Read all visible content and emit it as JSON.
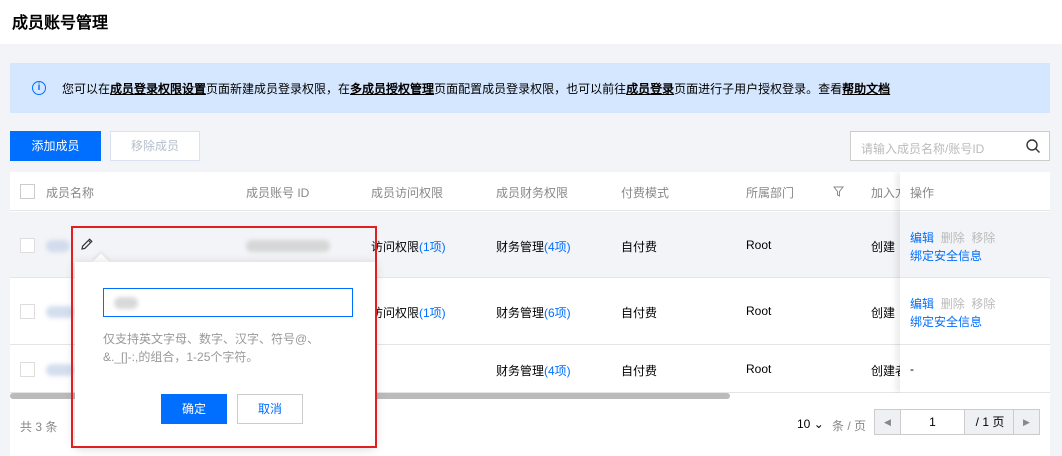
{
  "page": {
    "title": "成员账号管理"
  },
  "info": {
    "t1": "您可以在",
    "l1": "成员登录权限设置",
    "t2": "页面新建成员登录权限，在",
    "l2": "多成员授权管理",
    "t3": "页面配置成员登录权限，也可以前往",
    "l3": "成员登录",
    "t4": "页面进行子用户授权登录。查看",
    "l4": "帮助文档"
  },
  "toolbar": {
    "add_label": "添加成员",
    "remove_label": "移除成员"
  },
  "search": {
    "placeholder": "请输入成员名称/账号ID"
  },
  "table": {
    "headers": {
      "name": "成员名称",
      "account_id": "成员账号 ID",
      "access": "成员访问权限",
      "finance": "成员财务权限",
      "pay_mode": "付费模式",
      "dept": "所属部门",
      "join": "加入方",
      "ops": "操作"
    },
    "rows": [
      {
        "access_prefix": "访问权限",
        "access_count": "(1项)",
        "finance_prefix": "财务管理",
        "finance_count": "(4项)",
        "pay_mode": "自付费",
        "dept": "Root",
        "join": "创建",
        "ops": {
          "edit": "编辑",
          "delete": "删除",
          "remove": "移除",
          "bind": "绑定安全信息"
        }
      },
      {
        "access_prefix": "访问权限",
        "access_count": "(1项)",
        "finance_prefix": "财务管理",
        "finance_count": "(6项)",
        "pay_mode": "自付费",
        "dept": "Root",
        "join": "创建",
        "ops": {
          "edit": "编辑",
          "delete": "删除",
          "remove": "移除",
          "bind": "绑定安全信息"
        }
      },
      {
        "access_prefix": "",
        "access_count": "",
        "finance_prefix": "财务管理",
        "finance_count": "(4项)",
        "pay_mode": "自付费",
        "dept": "Root",
        "join": "创建者",
        "ops": {
          "dash": "-"
        }
      }
    ]
  },
  "footer": {
    "total": "共 3 条",
    "page_size": "10",
    "page_unit": "条 / 页",
    "page_current": "1",
    "page_total": "/ 1 页"
  },
  "popover": {
    "hint": "仅支持英文字母、数字、汉字、符号@、&._[]-:,的组合，1-25个字符。",
    "ok": "确定",
    "cancel": "取消"
  },
  "colors": {
    "primary": "#006eff",
    "info_bg": "#d5e7ff",
    "highlight_frame": "#e02020"
  }
}
